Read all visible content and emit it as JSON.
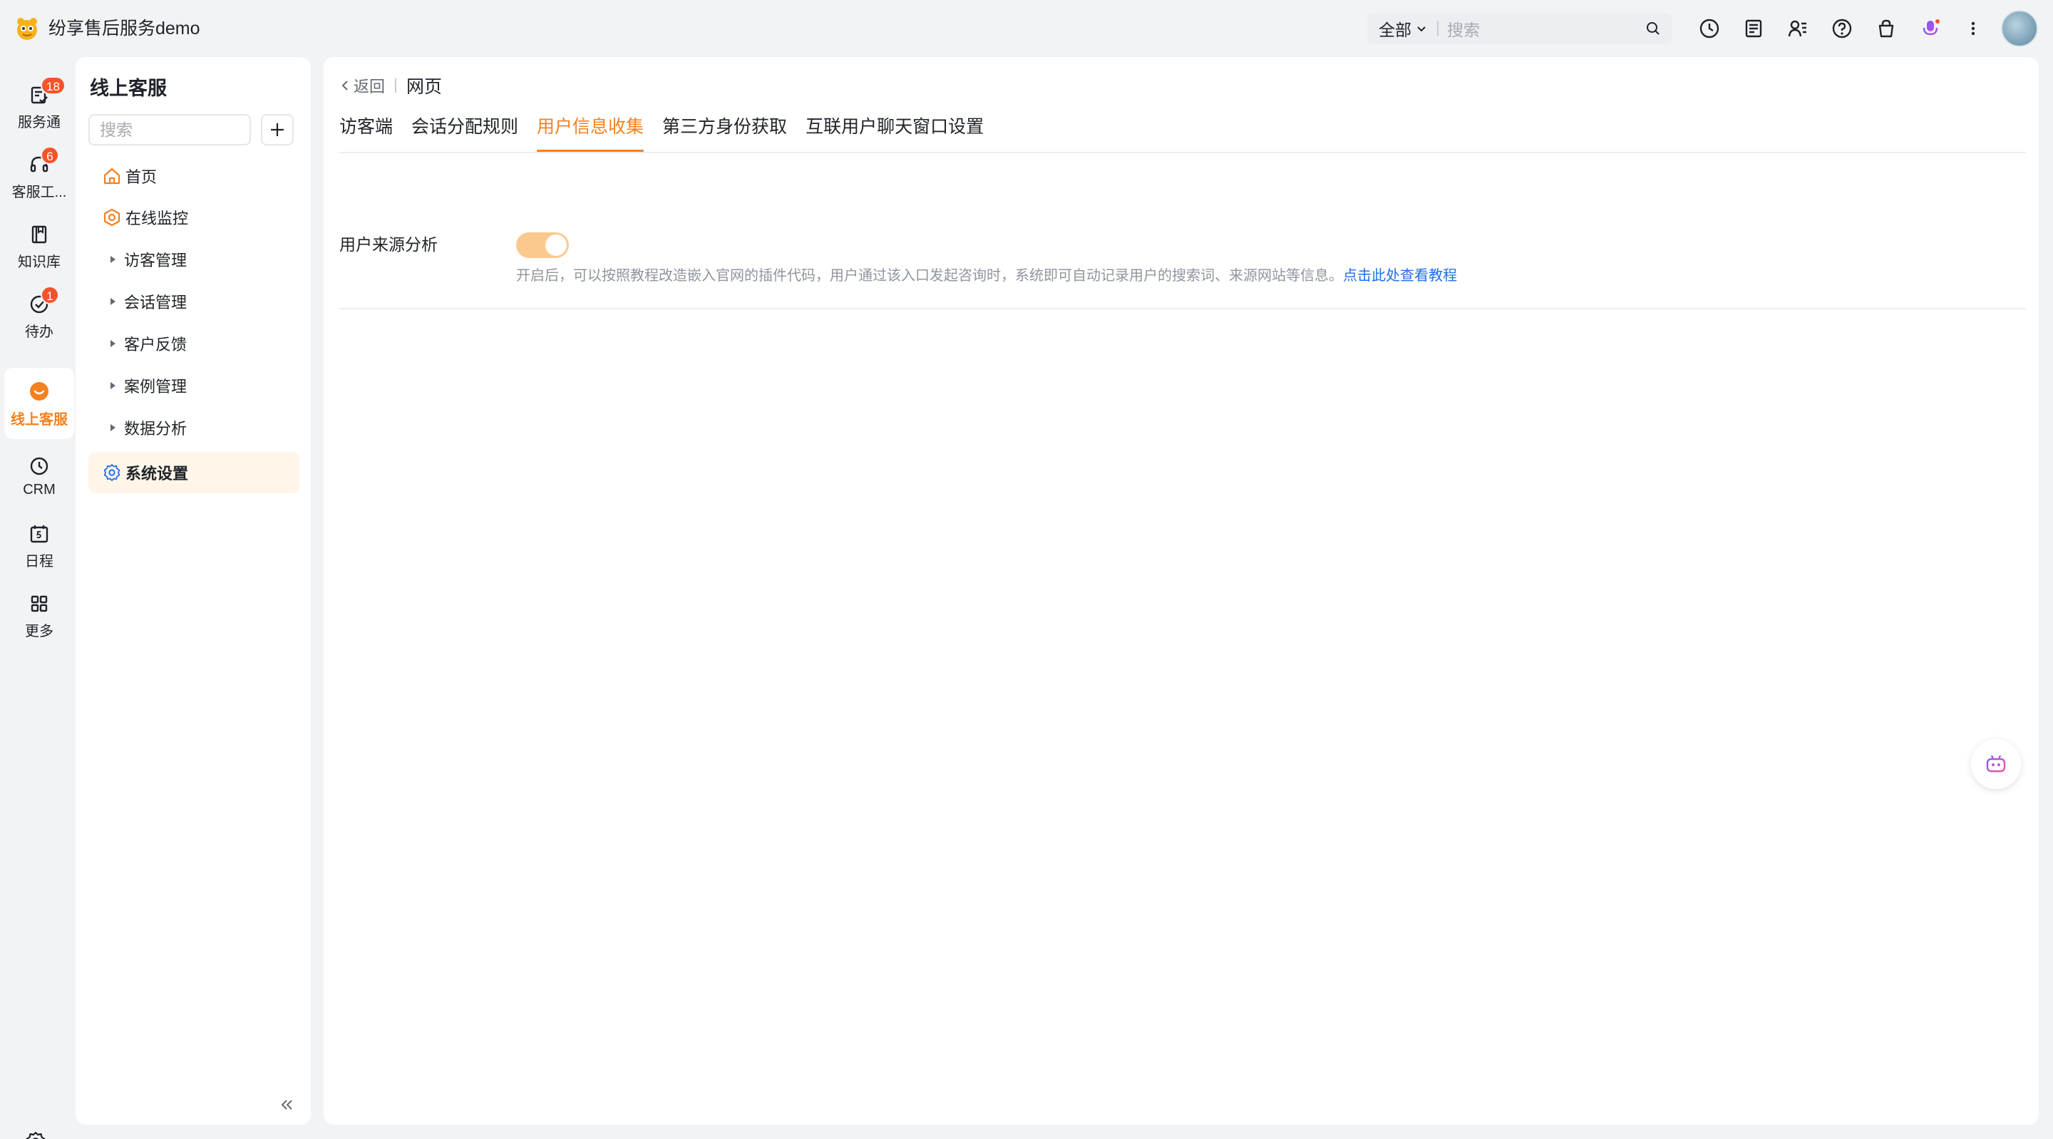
{
  "app": {
    "title": "纷享售后服务demo"
  },
  "topbar": {
    "search": {
      "scope": "全部",
      "placeholder": "搜索"
    },
    "icons": [
      "clock-icon",
      "notes-icon",
      "contacts-icon",
      "help-icon",
      "bag-icon",
      "voice-assistant-icon",
      "more-icon",
      "avatar"
    ]
  },
  "rail": {
    "items": [
      {
        "label": "服务通",
        "icon": "service-icon",
        "badge": "18"
      },
      {
        "label": "客服工...",
        "icon": "headset-icon",
        "badge": "6"
      },
      {
        "label": "知识库",
        "icon": "book-icon",
        "badge": ""
      },
      {
        "label": "待办",
        "icon": "check-circle-icon",
        "badge": "1"
      },
      {
        "label": "线上客服",
        "icon": "chat-bubble-icon",
        "badge": "",
        "active": true
      },
      {
        "label": "CRM",
        "icon": "crm-clock-icon",
        "badge": ""
      },
      {
        "label": "日程",
        "icon": "calendar-icon",
        "badge": ""
      },
      {
        "label": "更多",
        "icon": "grid-icon",
        "badge": ""
      }
    ]
  },
  "subnav": {
    "title": "线上客服",
    "search_placeholder": "搜索",
    "items": [
      {
        "label": "首页",
        "type": "icon"
      },
      {
        "label": "在线监控",
        "type": "icon"
      },
      {
        "label": "访客管理",
        "type": "group"
      },
      {
        "label": "会话管理",
        "type": "group"
      },
      {
        "label": "客户反馈",
        "type": "group"
      },
      {
        "label": "案例管理",
        "type": "group"
      },
      {
        "label": "数据分析",
        "type": "group"
      },
      {
        "label": "系统设置",
        "type": "icon",
        "active": true
      }
    ]
  },
  "main": {
    "back_label": "返回",
    "page_title": "网页",
    "tabs": [
      "访客端",
      "会话分配规则",
      "用户信息收集",
      "第三方身份获取",
      "互联用户聊天窗口设置"
    ],
    "active_tab": "用户信息收集",
    "settings": [
      {
        "label": "用户来源分析",
        "enabled": true,
        "description": "开启后，可以按照教程改造嵌入官网的插件代码，用户通过该入口发起咨询时，系统即可自动记录用户的搜索词、来源网站等信息。",
        "link_text": "点击此处查看教程"
      }
    ]
  },
  "colors": {
    "accent": "#f5811f",
    "link": "#1d6fe8",
    "badge": "#f5542a",
    "toggle_on": "#fbc98e"
  }
}
